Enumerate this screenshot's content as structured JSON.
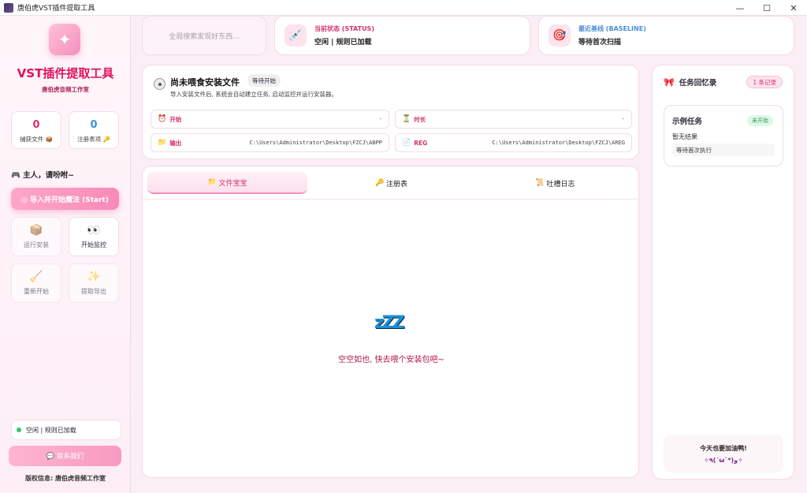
{
  "window": {
    "title": "唐伯虎VST插件提取工具",
    "minimize": "—",
    "maximize": "☐",
    "close": "✕"
  },
  "sidebar": {
    "logo": "✦",
    "app_name": "VST插件提取工具",
    "studio": "唐伯虎音频工作室",
    "stats": [
      {
        "value": "0",
        "label": "捕获文件 📦",
        "color": "#d5336f"
      },
      {
        "value": "0",
        "label": "注册表项 🔑",
        "color": "#3b8fe0"
      }
    ],
    "greeting": "🎮 主人，请吩咐~",
    "start_button": "◎ 导入并开始魔法 (Start)",
    "tools": [
      {
        "icon": "📦",
        "label": "运行安装",
        "disabled": true
      },
      {
        "icon": "👀",
        "label": "开始监控",
        "disabled": false
      },
      {
        "icon": "🧹",
        "label": "重新开始",
        "disabled": true
      },
      {
        "icon": "✨",
        "label": "提取导出",
        "disabled": true
      }
    ],
    "status": "空闲 | 规则已加载",
    "contact_button": "💬 联系我们",
    "copyright": "版权信息: 唐伯虎音频工作室"
  },
  "header": {
    "search_placeholder": "全局搜索发现好东西...",
    "status_card": {
      "icon": "💉",
      "title": "当前状态 (STATUS)",
      "value": "空闲 | 规则已加载"
    },
    "baseline_card": {
      "icon": "🎯",
      "title": "最近基线 (BASELINE)",
      "value": "等待首次扫描"
    }
  },
  "file_card": {
    "title": "尚未喂食安装文件",
    "badge": "等待开始",
    "description": "导入安装文件后, 系统会自动建立任务, 启动监控并运行安装器。",
    "fields": {
      "start": {
        "icon": "⏰",
        "label": "开始",
        "value": "-"
      },
      "duration": {
        "icon": "⏳",
        "label": "时长",
        "value": "-"
      },
      "output": {
        "icon": "📁",
        "label": "输出",
        "value": "C:\\Users\\Administrator\\Desktop\\FZCJ\\ABPP"
      },
      "reg": {
        "icon": "📄",
        "label": "REG",
        "value": "C:\\Users\\Administrator\\Desktop\\FZCJ\\AREG"
      }
    }
  },
  "tabs": [
    {
      "icon": "📁",
      "label": "文件宝宝"
    },
    {
      "icon": "🔑",
      "label": "注册表"
    },
    {
      "icon": "📜",
      "label": "吐槽日志"
    }
  ],
  "empty_state": {
    "icon": "zZZ",
    "text": "空空如也, 快去喂个安装包吧~"
  },
  "task_panel": {
    "title": "任务回忆录",
    "count": "1 条记录",
    "example": {
      "name": "示例任务",
      "badge": "未开始",
      "result": "暂无结果",
      "waiting": "等待首次执行"
    },
    "cheer_line1": "今天也要加油鸭!",
    "cheer_line2": "✧٩(ˊωˋ*)و✧"
  }
}
